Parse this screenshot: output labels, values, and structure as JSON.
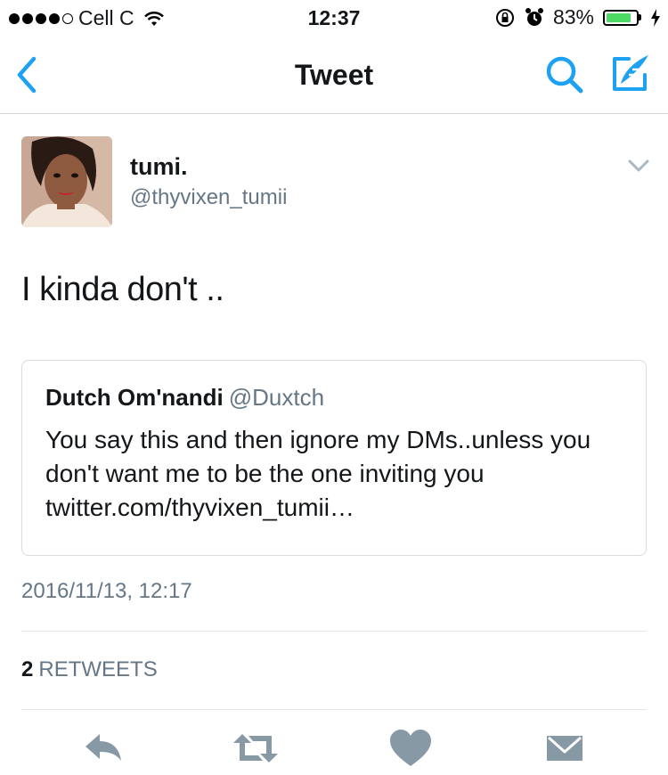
{
  "status_bar": {
    "carrier": "Cell C",
    "time": "12:37",
    "battery_percent": "83%",
    "battery_level": 0.83
  },
  "nav": {
    "title": "Tweet",
    "back_icon": "chevron-left-icon",
    "search_icon": "search-icon",
    "compose_icon": "compose-icon"
  },
  "tweet": {
    "author_name": "tumi.",
    "author_handle": "@thyvixen_tumii",
    "text": "I kinda don't ..",
    "timestamp": "2016/11/13, 12:17",
    "retweet_count": "2",
    "retweet_label": "RETWEETS"
  },
  "quoted_tweet": {
    "author_name": "Dutch Om'nandi",
    "author_handle": "@Duxtch",
    "text": "You say this and then ignore my DMs..unless you don't want me to be the one inviting you twitter.com/thyvixen_tumii…"
  },
  "actions": [
    {
      "icon": "reply-icon"
    },
    {
      "icon": "retweet-icon"
    },
    {
      "icon": "like-icon"
    },
    {
      "icon": "direct-message-icon"
    }
  ],
  "colors": {
    "accent": "#1da1f2",
    "secondary_text": "#657786",
    "action_icon": "#8899a6",
    "battery_fill": "#4cd964"
  }
}
